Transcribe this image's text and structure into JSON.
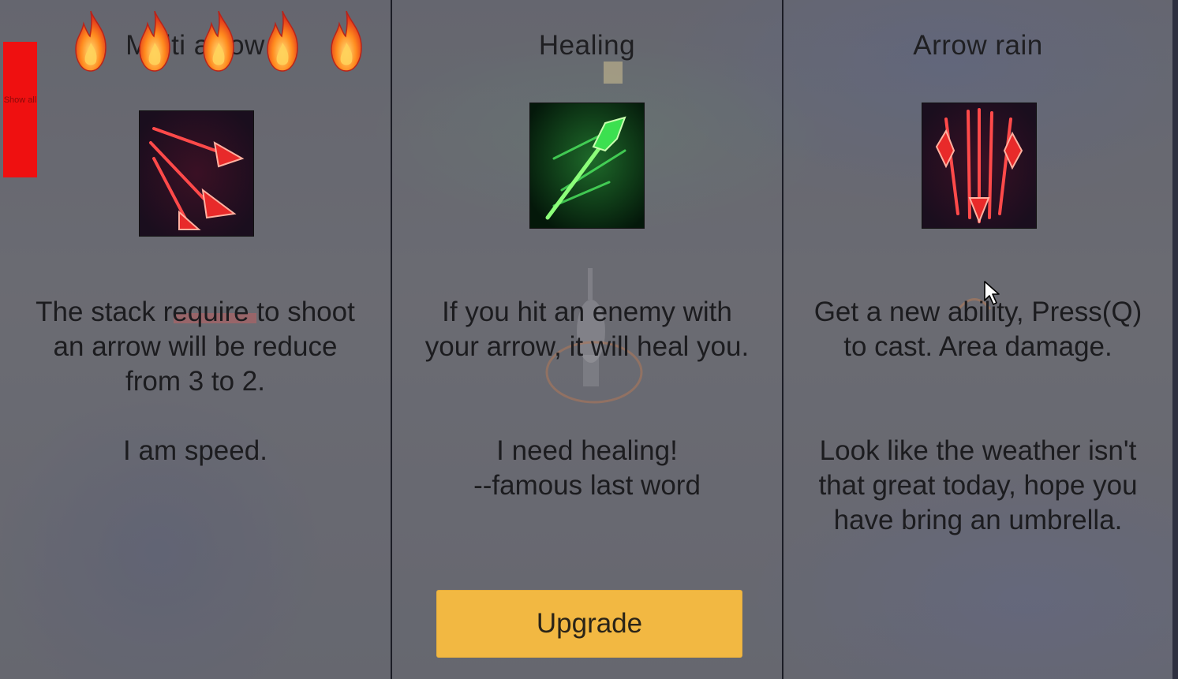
{
  "hud": {
    "show_all_label": "Show all",
    "fire_count": 5
  },
  "cards": [
    {
      "title": "Multi arrow",
      "icon": "multi-arrow-icon",
      "description": "The stack require to shoot an arrow will be reduce from 3 to 2.",
      "flavor": "I am speed."
    },
    {
      "title": "Healing",
      "icon": "healing-arrow-icon",
      "description": "If you hit an enemy with your arrow, it will heal you.",
      "flavor_line1": "I need healing!",
      "flavor_line2": "--famous last word",
      "button_label": "Upgrade"
    },
    {
      "title": "Arrow rain",
      "icon": "arrow-rain-icon",
      "description": "Get a new ability, Press(Q) to cast. Area damage.",
      "flavor": "Look like the weather isn't that great today, hope you have bring an umbrella."
    }
  ],
  "colors": {
    "button_accent": "#f2b842",
    "show_all_red": "#ef1010",
    "divider": "#1c1d26"
  }
}
